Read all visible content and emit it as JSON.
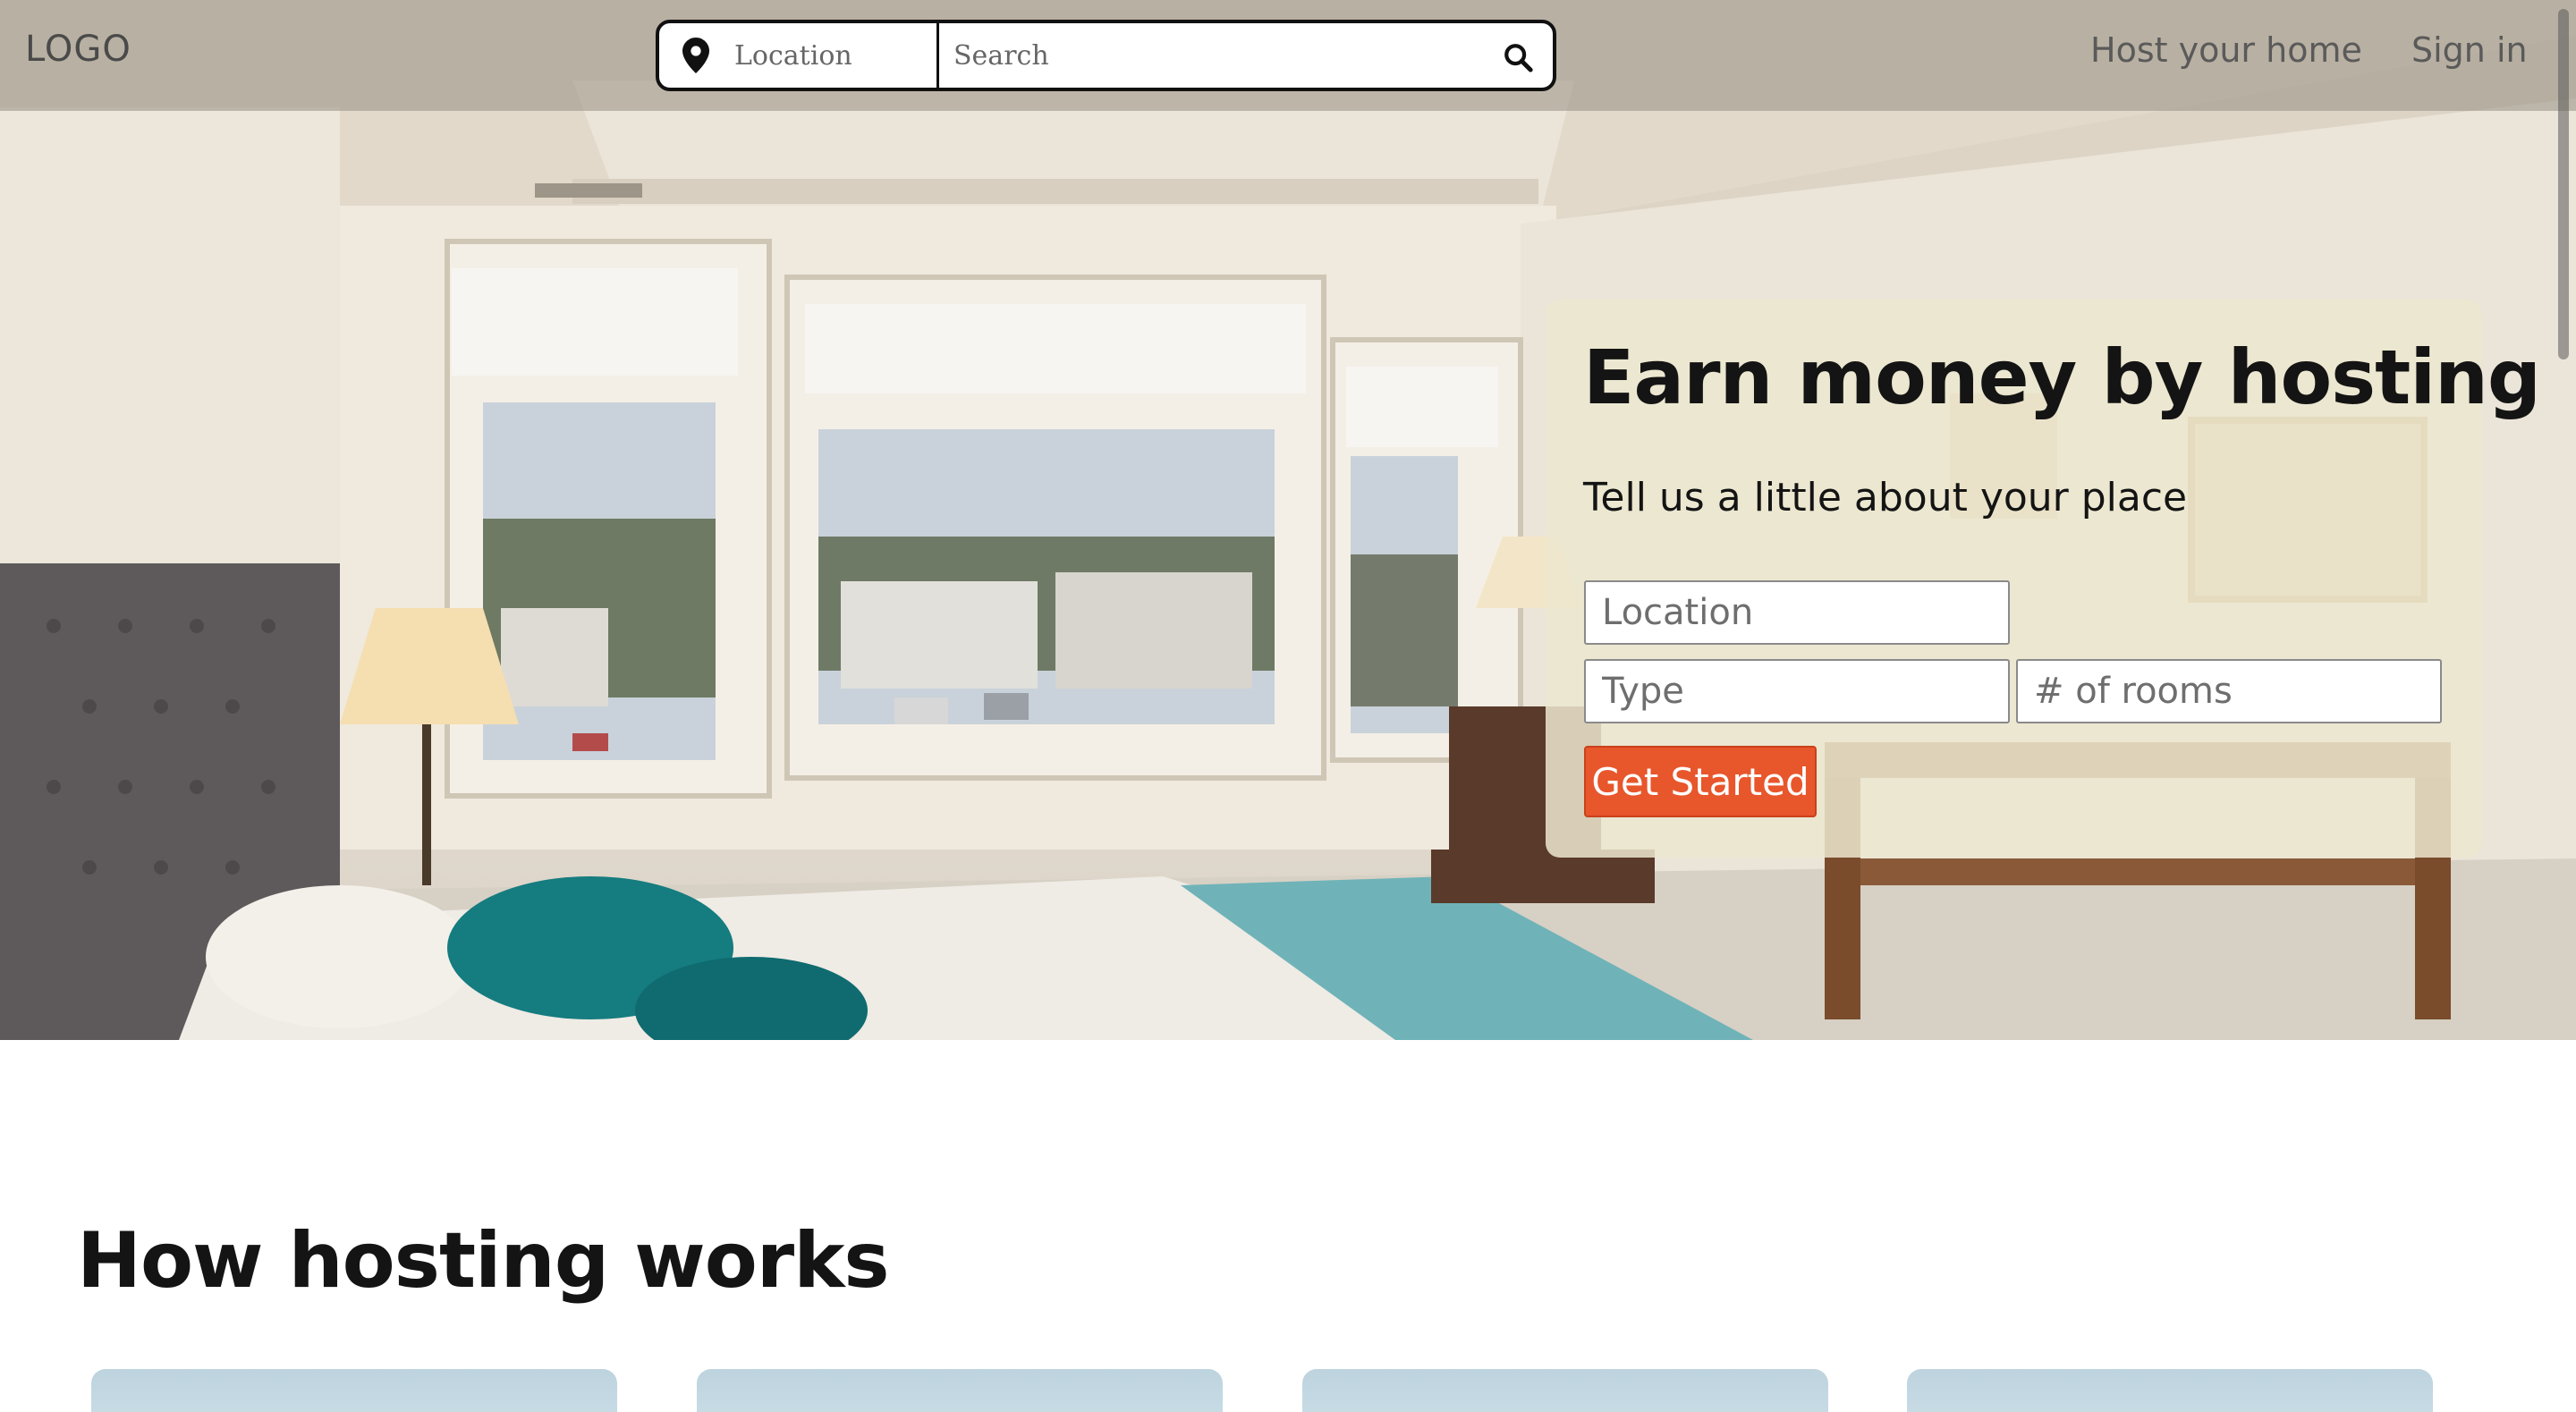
{
  "header": {
    "logo": "LOGO",
    "search": {
      "location_label": "Location",
      "placeholder": "Search",
      "icons": {
        "location": "map-pin-icon",
        "search": "search-icon"
      }
    },
    "nav": {
      "host_label": "Host your home",
      "signin_label": "Sign in"
    }
  },
  "hero": {
    "card": {
      "title": "Earn money by hosting",
      "subtitle": "Tell us a little about your place",
      "fields": {
        "location_placeholder": "Location",
        "type_placeholder": "Type",
        "rooms_placeholder": "# of rooms"
      },
      "cta_label": "Get Started",
      "cta_color": "#e8562c"
    }
  },
  "section": {
    "title": "How hosting works",
    "cards_count_note": ""
  }
}
